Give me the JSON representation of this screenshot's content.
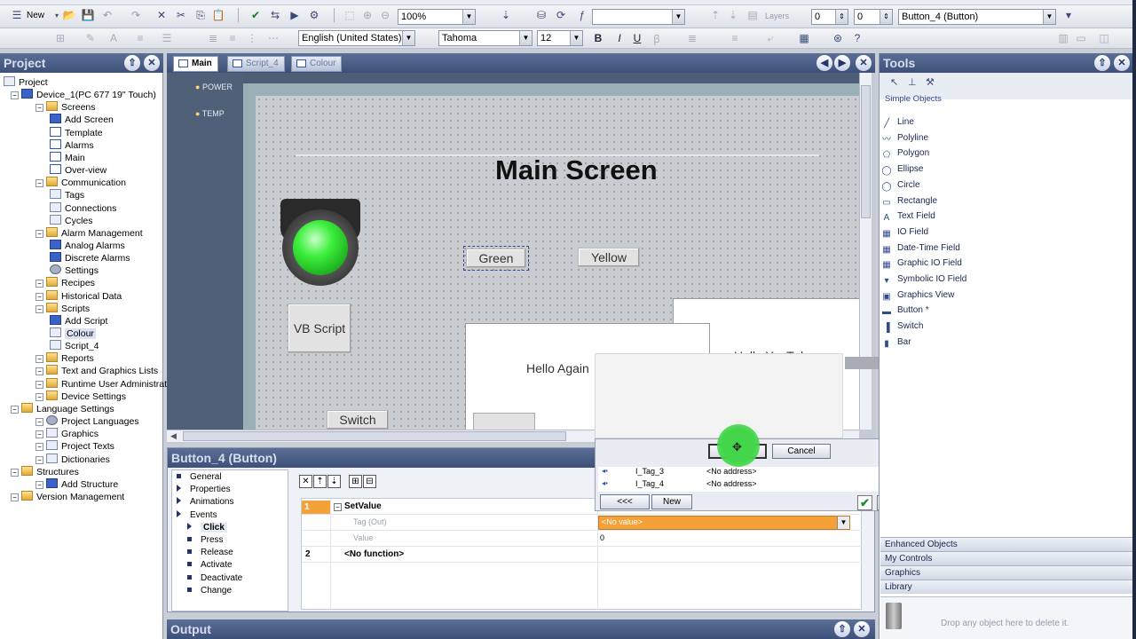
{
  "toolbar1": {
    "new_label": "New",
    "zoom": "100%",
    "layers_label": "Layers",
    "layer_from": "0",
    "layer_to": "0",
    "object_select": "Button_4 (Button)"
  },
  "toolbar2": {
    "language": "English (United States)",
    "font": "Tahoma",
    "font_size": "12",
    "bold": "B",
    "italic": "I",
    "underline": "U"
  },
  "project_panel": {
    "title": "Project",
    "tree": [
      {
        "label": "Project",
        "level": 0,
        "icon": "project-icon"
      },
      {
        "label": "Device_1(PC 677 19\" Touch)",
        "level": 1,
        "icon": "device-icon"
      },
      {
        "label": "Screens",
        "level": 2,
        "icon": "folder-icon"
      },
      {
        "label": "Add Screen",
        "level": 3,
        "icon": "add-icon"
      },
      {
        "label": "Template",
        "level": 3,
        "icon": "screen-icon"
      },
      {
        "label": "Alarms",
        "level": 3,
        "icon": "screen-icon"
      },
      {
        "label": "Main",
        "level": 3,
        "icon": "screen-icon"
      },
      {
        "label": "Over-view",
        "level": 3,
        "icon": "screen-icon"
      },
      {
        "label": "Communication",
        "level": 2,
        "icon": "folder-icon"
      },
      {
        "label": "Tags",
        "level": 3,
        "icon": "tags-icon"
      },
      {
        "label": "Connections",
        "level": 3,
        "icon": "connection-icon"
      },
      {
        "label": "Cycles",
        "level": 3,
        "icon": "cycle-icon"
      },
      {
        "label": "Alarm Management",
        "level": 2,
        "icon": "folder-icon"
      },
      {
        "label": "Analog Alarms",
        "level": 3,
        "icon": "alarm-icon"
      },
      {
        "label": "Discrete Alarms",
        "level": 3,
        "icon": "alarm-icon"
      },
      {
        "label": "Settings",
        "level": 3,
        "icon": "settings-icon"
      },
      {
        "label": "Recipes",
        "level": 2,
        "icon": "folder-icon"
      },
      {
        "label": "Historical Data",
        "level": 2,
        "icon": "folder-icon"
      },
      {
        "label": "Scripts",
        "level": 2,
        "icon": "folder-icon"
      },
      {
        "label": "Add Script",
        "level": 3,
        "icon": "add-icon"
      },
      {
        "label": "Colour",
        "level": 3,
        "icon": "script-icon",
        "selected": true
      },
      {
        "label": "Script_4",
        "level": 3,
        "icon": "script-icon"
      },
      {
        "label": "Reports",
        "level": 2,
        "icon": "folder-icon"
      },
      {
        "label": "Text and Graphics Lists",
        "level": 2,
        "icon": "folder-icon"
      },
      {
        "label": "Runtime User Administration",
        "level": 2,
        "icon": "folder-icon"
      },
      {
        "label": "Device Settings",
        "level": 2,
        "icon": "folder-icon"
      },
      {
        "label": "Language Settings",
        "level": 1,
        "icon": "folder-icon"
      },
      {
        "label": "Project Languages",
        "level": 2,
        "icon": "globe-icon"
      },
      {
        "label": "Graphics",
        "level": 2,
        "icon": "graphics-icon"
      },
      {
        "label": "Project Texts",
        "level": 2,
        "icon": "text-icon"
      },
      {
        "label": "Dictionaries",
        "level": 2,
        "icon": "dictionary-icon"
      },
      {
        "label": "Structures",
        "level": 1,
        "icon": "folder-icon"
      },
      {
        "label": "Add Structure",
        "level": 2,
        "icon": "add-icon"
      },
      {
        "label": "Version Management",
        "level": 1,
        "icon": "folder-icon"
      }
    ]
  },
  "editor": {
    "tabs": [
      "Main",
      "Script_4",
      "Colour"
    ],
    "indicators": [
      "POWER",
      "TEMP"
    ],
    "screen_title": "Main Screen",
    "buttons": {
      "green": "Green",
      "yellow": "Yellow",
      "vb_script": "VB Script",
      "switch": "Switch"
    },
    "hello_again": "Hello Again",
    "hello_youtube": "Hello YouTube"
  },
  "properties": {
    "title": "Button_4 (Button)",
    "nav": [
      "General",
      "Properties",
      "Animations",
      "Events",
      "Click",
      "Press",
      "Release",
      "Activate",
      "Deactivate",
      "Change"
    ],
    "rows": [
      {
        "num": "1",
        "label": "SetValue"
      },
      {
        "label": "Tag (Out)",
        "value": "<No value>"
      },
      {
        "label": "Value",
        "value": "0"
      },
      {
        "num": "2",
        "label": "<No function>"
      }
    ]
  },
  "tag_dialog": {
    "back_label": "<<<",
    "new_label": "New",
    "cancel_label": "Cancel",
    "rows": [
      {
        "name": "I_Tag_3",
        "address": "<No address>"
      },
      {
        "name": "I_Tag_4",
        "address": "<No address>"
      }
    ]
  },
  "tools_panel": {
    "title": "Tools",
    "section": "Simple Objects",
    "items": [
      "Line",
      "Polyline",
      "Polygon",
      "Ellipse",
      "Circle",
      "Rectangle",
      "Text Field",
      "IO Field",
      "Date-Time Field",
      "Graphic IO Field",
      "Symbolic IO Field",
      "Graphics View",
      "Button *",
      "Switch",
      "Bar"
    ],
    "categories": [
      "Enhanced Objects",
      "My Controls",
      "Graphics",
      "Library"
    ],
    "trash_hint": "Drop any object here to delete it."
  },
  "output_panel": {
    "title": "Output"
  },
  "colors": {
    "panel_title": "#4a5d86",
    "orange_highlight": "#f4a13a",
    "led_green": "#22dd22"
  }
}
